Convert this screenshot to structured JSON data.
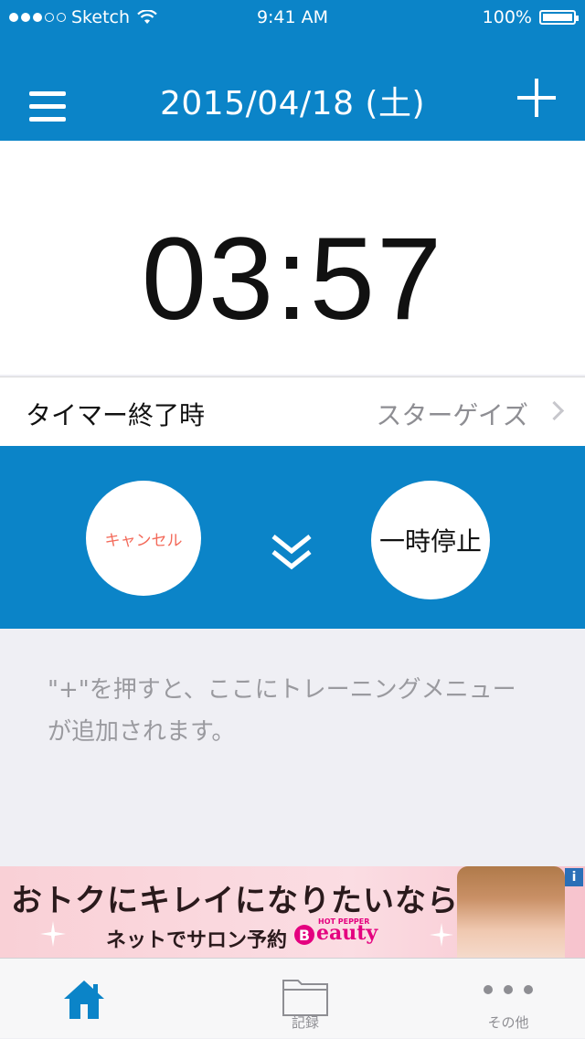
{
  "status_bar": {
    "carrier": "Sketch",
    "time": "9:41 AM",
    "battery_percent": "100%",
    "signal_bars": 3,
    "signal_total": 5
  },
  "navbar": {
    "title": "2015/04/18 (土)",
    "menu_icon": "hamburger-icon",
    "add_icon": "plus-icon"
  },
  "timer": {
    "display": "03:57"
  },
  "timer_end_setting": {
    "label": "タイマー終了時",
    "value": "スターゲイズ"
  },
  "controls": {
    "cancel_label": "キャンセル",
    "pause_label": "一時停止",
    "collapse_icon": "double-chevron-down-icon"
  },
  "hint": {
    "line1": "\"+\"を押すと、ここにトレーニングメニュー",
    "line2": "が追加されます。"
  },
  "ad": {
    "headline": "おトクにキレイになりたいなら♥",
    "subline": "ネットでサロン予約",
    "brand_small": "HOT PEPPER",
    "brand": "eauty",
    "brand_initial": "B",
    "info_label": "i"
  },
  "tab_bar": {
    "tabs": [
      {
        "label": "",
        "icon": "home-icon",
        "active": true
      },
      {
        "label": "記録",
        "icon": "folder-icon",
        "active": false
      },
      {
        "label": "その他",
        "icon": "more-icon",
        "active": false
      }
    ]
  },
  "colors": {
    "brand_blue": "#0b84c8",
    "cancel_red": "#f36a5a",
    "background_gray": "#efeff4"
  }
}
